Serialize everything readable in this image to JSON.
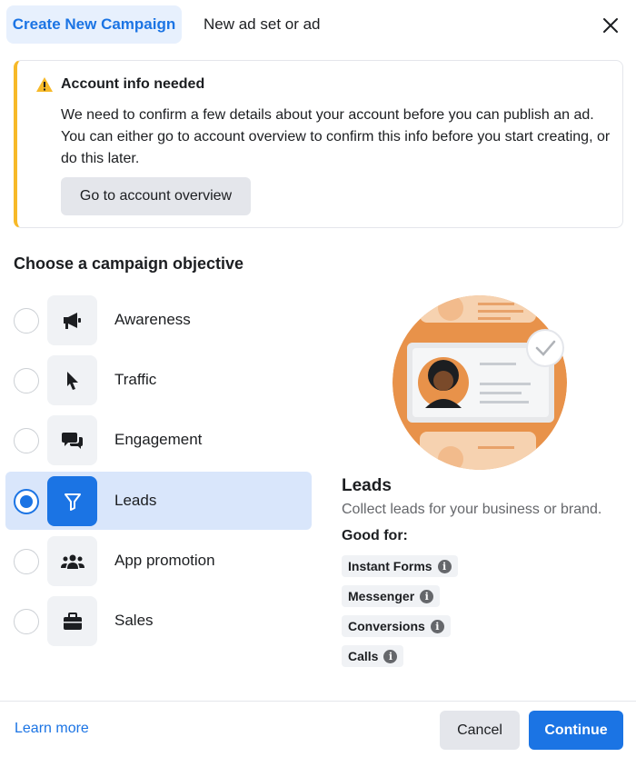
{
  "header": {
    "active_tab": "Create New Campaign",
    "tab": "New ad set or ad",
    "close_icon": "close-icon"
  },
  "alert": {
    "icon": "warning-icon",
    "title": "Account info needed",
    "body": "We need to confirm a few details about your account before you can publish an ad. You can either go to account overview to confirm this info before you start creating, or do this later.",
    "button": "Go to account overview"
  },
  "section_title": "Choose a campaign objective",
  "objectives": [
    {
      "label": "Awareness",
      "icon": "megaphone-icon",
      "selected": false
    },
    {
      "label": "Traffic",
      "icon": "cursor-icon",
      "selected": false
    },
    {
      "label": "Engagement",
      "icon": "chat-bubbles-icon",
      "selected": false
    },
    {
      "label": "Leads",
      "icon": "filter-icon",
      "selected": true
    },
    {
      "label": "App promotion",
      "icon": "people-icon",
      "selected": false
    },
    {
      "label": "Sales",
      "icon": "briefcase-icon",
      "selected": false
    }
  ],
  "detail": {
    "title": "Leads",
    "description": "Collect leads for your business or brand.",
    "good_for_label": "Good for:",
    "chips": [
      "Instant Forms",
      "Messenger",
      "Conversions",
      "Calls"
    ]
  },
  "footer": {
    "learn_more": "Learn more",
    "cancel": "Cancel",
    "continue": "Continue"
  },
  "colors": {
    "accent": "#1b74e4",
    "selected_bg": "#d9e6fb",
    "warning": "#f7b928",
    "illustration_orange": "#e8924a"
  }
}
